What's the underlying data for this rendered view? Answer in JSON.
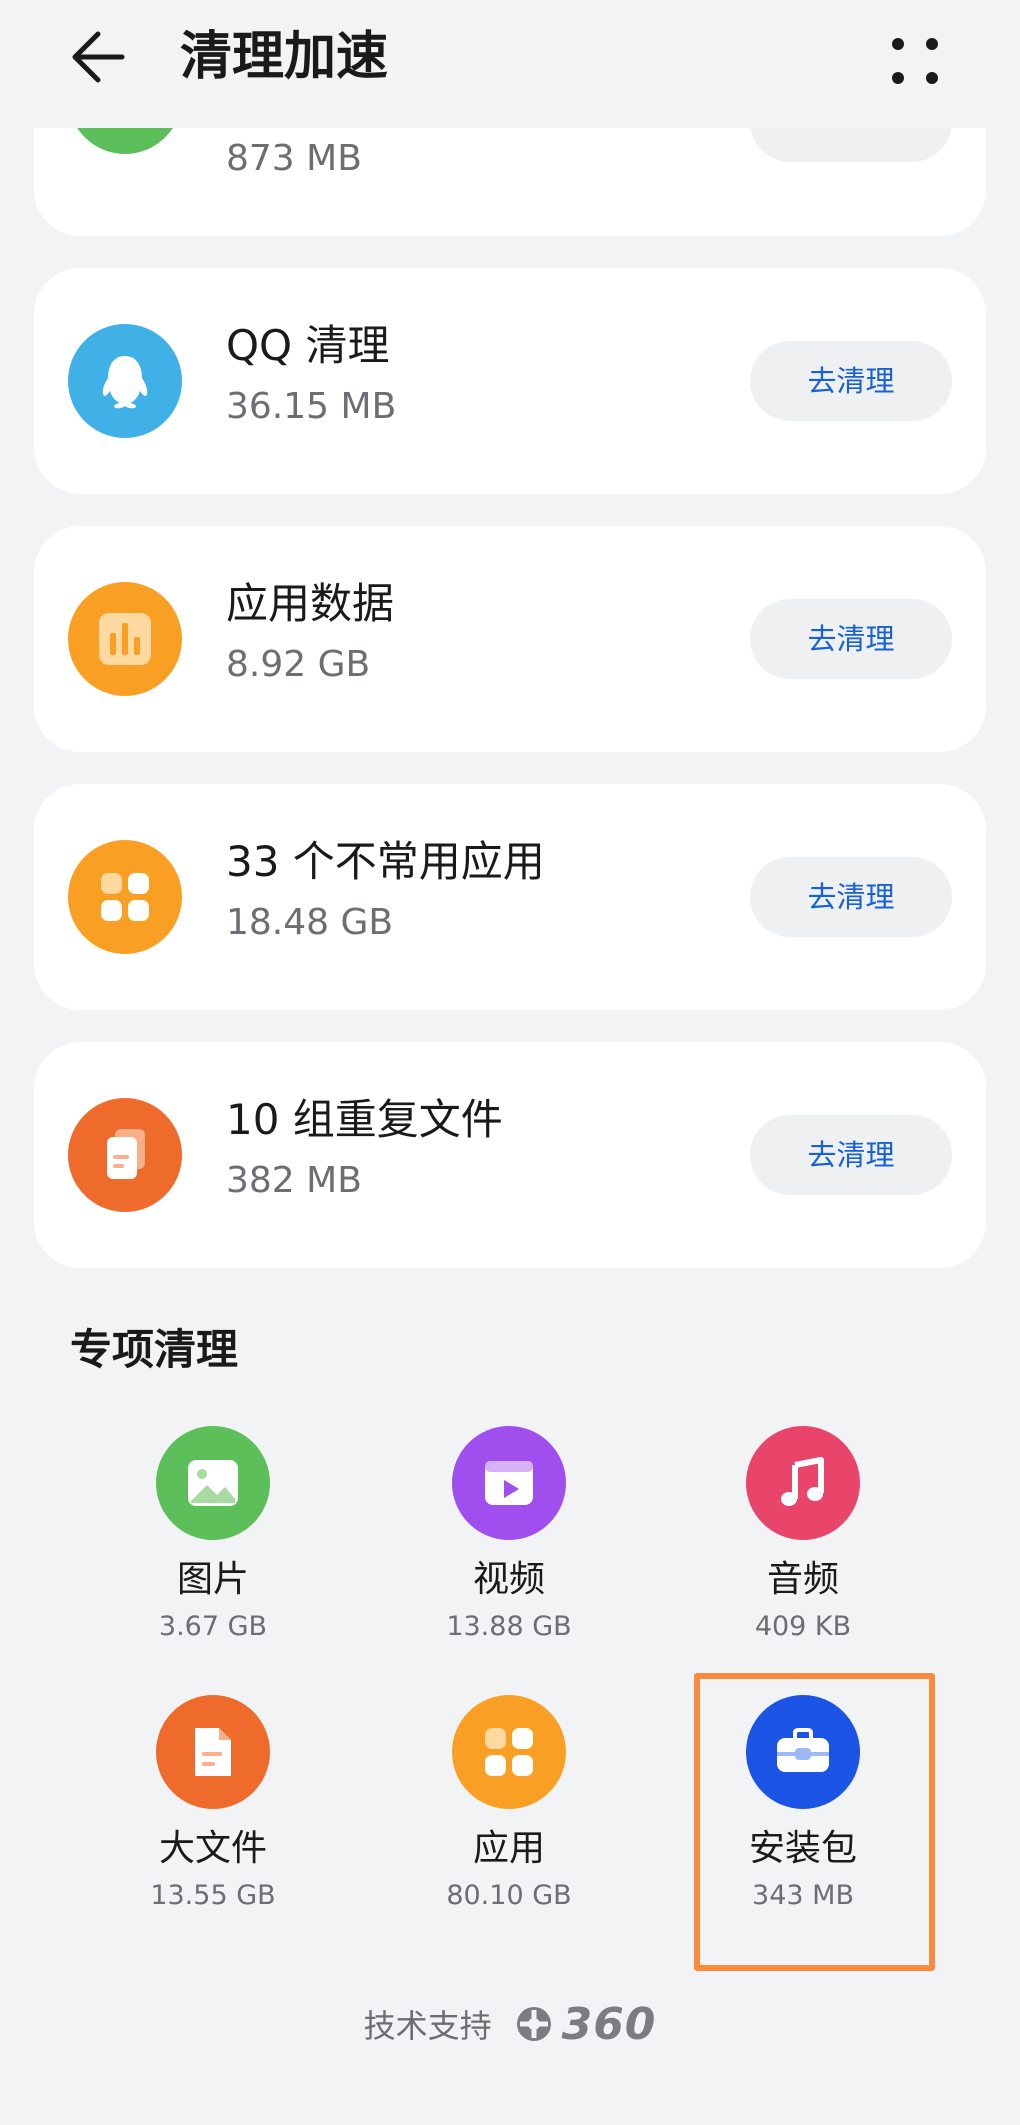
{
  "header": {
    "title": "清理加速",
    "back_icon": "arrow-left-icon",
    "more_icon": "more-dots-icon"
  },
  "cards": [
    {
      "name": "",
      "size": "873 MB",
      "button": "",
      "icon": "wechat-icon",
      "color": "#5cbf5a"
    },
    {
      "name": "QQ 清理",
      "size": "36.15 MB",
      "button": "去清理",
      "icon": "qq-penguin-icon",
      "color": "#40b1e6"
    },
    {
      "name": "应用数据",
      "size": "8.92 GB",
      "button": "去清理",
      "icon": "bar-chart-icon",
      "color": "#f9a024"
    },
    {
      "name": "33 个不常用应用",
      "size": "18.48 GB",
      "button": "去清理",
      "icon": "apps-grid-icon",
      "color": "#f9a024"
    },
    {
      "name": "10 组重复文件",
      "size": "382 MB",
      "button": "去清理",
      "icon": "duplicate-files-icon",
      "color": "#ef6b2c"
    }
  ],
  "special": {
    "title": "专项清理",
    "items": [
      {
        "name": "图片",
        "size": "3.67 GB",
        "icon": "image-icon",
        "color": "#5cbf5a"
      },
      {
        "name": "视频",
        "size": "13.88 GB",
        "icon": "video-icon",
        "color": "#a04fee"
      },
      {
        "name": "音频",
        "size": "409 KB",
        "icon": "music-note-icon",
        "color": "#e9446a"
      },
      {
        "name": "大文件",
        "size": "13.55 GB",
        "icon": "document-icon",
        "color": "#ef6b2c"
      },
      {
        "name": "应用",
        "size": "80.10 GB",
        "icon": "apps-grid-icon",
        "color": "#f9a024"
      },
      {
        "name": "安装包",
        "size": "343 MB",
        "icon": "toolbox-icon",
        "color": "#1c55e6"
      }
    ]
  },
  "footer": {
    "text": "技术支持",
    "logo_text": "360"
  },
  "colors": {
    "accent_button_text": "#1660d8",
    "highlight": "#f98b3c"
  }
}
